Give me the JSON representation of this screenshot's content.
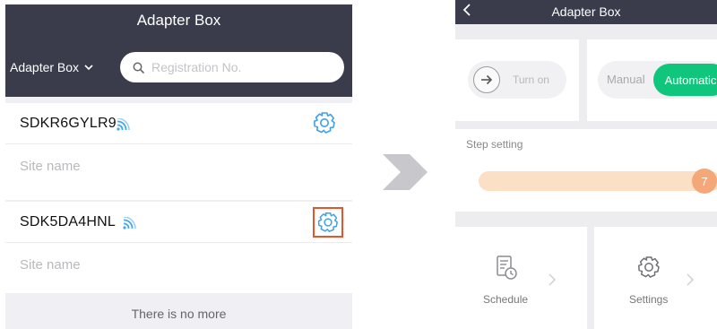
{
  "left_screen": {
    "title": "Adapter Box",
    "type_selector": "Adapter Box",
    "search": {
      "placeholder": "Registration No.",
      "value": ""
    },
    "devices": [
      {
        "id": "SDKR6GYLR9",
        "site_name_placeholder": "Site name",
        "wifi_icon": "wifi-signal-icon",
        "settings_icon": "gear-icon"
      },
      {
        "id": "SDK5DA4HNL",
        "site_name_placeholder": "Site name",
        "wifi_icon": "wifi-signal-icon",
        "settings_icon": "gear-icon"
      }
    ],
    "footer": "There is no more"
  },
  "right_screen": {
    "title": "Adapter Box",
    "power": {
      "label": "Turn on",
      "icon": "arrow-right-icon"
    },
    "mode": {
      "manual_label": "Manual",
      "automatic_label": "Automatic",
      "selected": "Automatic"
    },
    "step": {
      "label": "Step setting",
      "value": "7"
    },
    "tiles": [
      {
        "label": "Schedule",
        "icon": "schedule-icon"
      },
      {
        "label": "Settings",
        "icon": "gear-icon"
      }
    ]
  },
  "colors": {
    "header": "#3a3c4c",
    "accent_green": "#10c67c",
    "highlight_border": "#e2562f",
    "wifi_blue": "#41a8f0",
    "gear_blue": "#3f9fea",
    "slider_track": "#fbe0c6",
    "slider_knob": "#f4a87a"
  }
}
